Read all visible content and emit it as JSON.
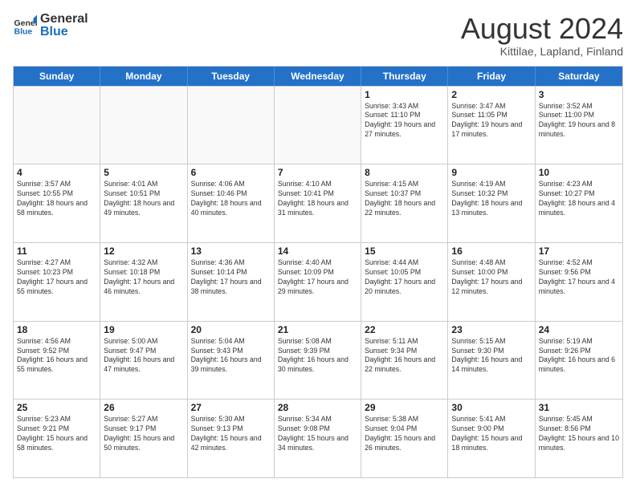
{
  "logo": {
    "general": "General",
    "blue": "Blue"
  },
  "title": "August 2024",
  "subtitle": "Kittilae, Lapland, Finland",
  "header": {
    "days": [
      "Sunday",
      "Monday",
      "Tuesday",
      "Wednesday",
      "Thursday",
      "Friday",
      "Saturday"
    ]
  },
  "weeks": [
    [
      {
        "day": "",
        "info": ""
      },
      {
        "day": "",
        "info": ""
      },
      {
        "day": "",
        "info": ""
      },
      {
        "day": "",
        "info": ""
      },
      {
        "day": "1",
        "info": "Sunrise: 3:43 AM\nSunset: 11:10 PM\nDaylight: 19 hours and 27 minutes."
      },
      {
        "day": "2",
        "info": "Sunrise: 3:47 AM\nSunset: 11:05 PM\nDaylight: 19 hours and 17 minutes."
      },
      {
        "day": "3",
        "info": "Sunrise: 3:52 AM\nSunset: 11:00 PM\nDaylight: 19 hours and 8 minutes."
      }
    ],
    [
      {
        "day": "4",
        "info": "Sunrise: 3:57 AM\nSunset: 10:55 PM\nDaylight: 18 hours and 58 minutes."
      },
      {
        "day": "5",
        "info": "Sunrise: 4:01 AM\nSunset: 10:51 PM\nDaylight: 18 hours and 49 minutes."
      },
      {
        "day": "6",
        "info": "Sunrise: 4:06 AM\nSunset: 10:46 PM\nDaylight: 18 hours and 40 minutes."
      },
      {
        "day": "7",
        "info": "Sunrise: 4:10 AM\nSunset: 10:41 PM\nDaylight: 18 hours and 31 minutes."
      },
      {
        "day": "8",
        "info": "Sunrise: 4:15 AM\nSunset: 10:37 PM\nDaylight: 18 hours and 22 minutes."
      },
      {
        "day": "9",
        "info": "Sunrise: 4:19 AM\nSunset: 10:32 PM\nDaylight: 18 hours and 13 minutes."
      },
      {
        "day": "10",
        "info": "Sunrise: 4:23 AM\nSunset: 10:27 PM\nDaylight: 18 hours and 4 minutes."
      }
    ],
    [
      {
        "day": "11",
        "info": "Sunrise: 4:27 AM\nSunset: 10:23 PM\nDaylight: 17 hours and 55 minutes."
      },
      {
        "day": "12",
        "info": "Sunrise: 4:32 AM\nSunset: 10:18 PM\nDaylight: 17 hours and 46 minutes."
      },
      {
        "day": "13",
        "info": "Sunrise: 4:36 AM\nSunset: 10:14 PM\nDaylight: 17 hours and 38 minutes."
      },
      {
        "day": "14",
        "info": "Sunrise: 4:40 AM\nSunset: 10:09 PM\nDaylight: 17 hours and 29 minutes."
      },
      {
        "day": "15",
        "info": "Sunrise: 4:44 AM\nSunset: 10:05 PM\nDaylight: 17 hours and 20 minutes."
      },
      {
        "day": "16",
        "info": "Sunrise: 4:48 AM\nSunset: 10:00 PM\nDaylight: 17 hours and 12 minutes."
      },
      {
        "day": "17",
        "info": "Sunrise: 4:52 AM\nSunset: 9:56 PM\nDaylight: 17 hours and 4 minutes."
      }
    ],
    [
      {
        "day": "18",
        "info": "Sunrise: 4:56 AM\nSunset: 9:52 PM\nDaylight: 16 hours and 55 minutes."
      },
      {
        "day": "19",
        "info": "Sunrise: 5:00 AM\nSunset: 9:47 PM\nDaylight: 16 hours and 47 minutes."
      },
      {
        "day": "20",
        "info": "Sunrise: 5:04 AM\nSunset: 9:43 PM\nDaylight: 16 hours and 39 minutes."
      },
      {
        "day": "21",
        "info": "Sunrise: 5:08 AM\nSunset: 9:39 PM\nDaylight: 16 hours and 30 minutes."
      },
      {
        "day": "22",
        "info": "Sunrise: 5:11 AM\nSunset: 9:34 PM\nDaylight: 16 hours and 22 minutes."
      },
      {
        "day": "23",
        "info": "Sunrise: 5:15 AM\nSunset: 9:30 PM\nDaylight: 16 hours and 14 minutes."
      },
      {
        "day": "24",
        "info": "Sunrise: 5:19 AM\nSunset: 9:26 PM\nDaylight: 16 hours and 6 minutes."
      }
    ],
    [
      {
        "day": "25",
        "info": "Sunrise: 5:23 AM\nSunset: 9:21 PM\nDaylight: 15 hours and 58 minutes."
      },
      {
        "day": "26",
        "info": "Sunrise: 5:27 AM\nSunset: 9:17 PM\nDaylight: 15 hours and 50 minutes."
      },
      {
        "day": "27",
        "info": "Sunrise: 5:30 AM\nSunset: 9:13 PM\nDaylight: 15 hours and 42 minutes."
      },
      {
        "day": "28",
        "info": "Sunrise: 5:34 AM\nSunset: 9:08 PM\nDaylight: 15 hours and 34 minutes."
      },
      {
        "day": "29",
        "info": "Sunrise: 5:38 AM\nSunset: 9:04 PM\nDaylight: 15 hours and 26 minutes."
      },
      {
        "day": "30",
        "info": "Sunrise: 5:41 AM\nSunset: 9:00 PM\nDaylight: 15 hours and 18 minutes."
      },
      {
        "day": "31",
        "info": "Sunrise: 5:45 AM\nSunset: 8:56 PM\nDaylight: 15 hours and 10 minutes."
      }
    ]
  ]
}
